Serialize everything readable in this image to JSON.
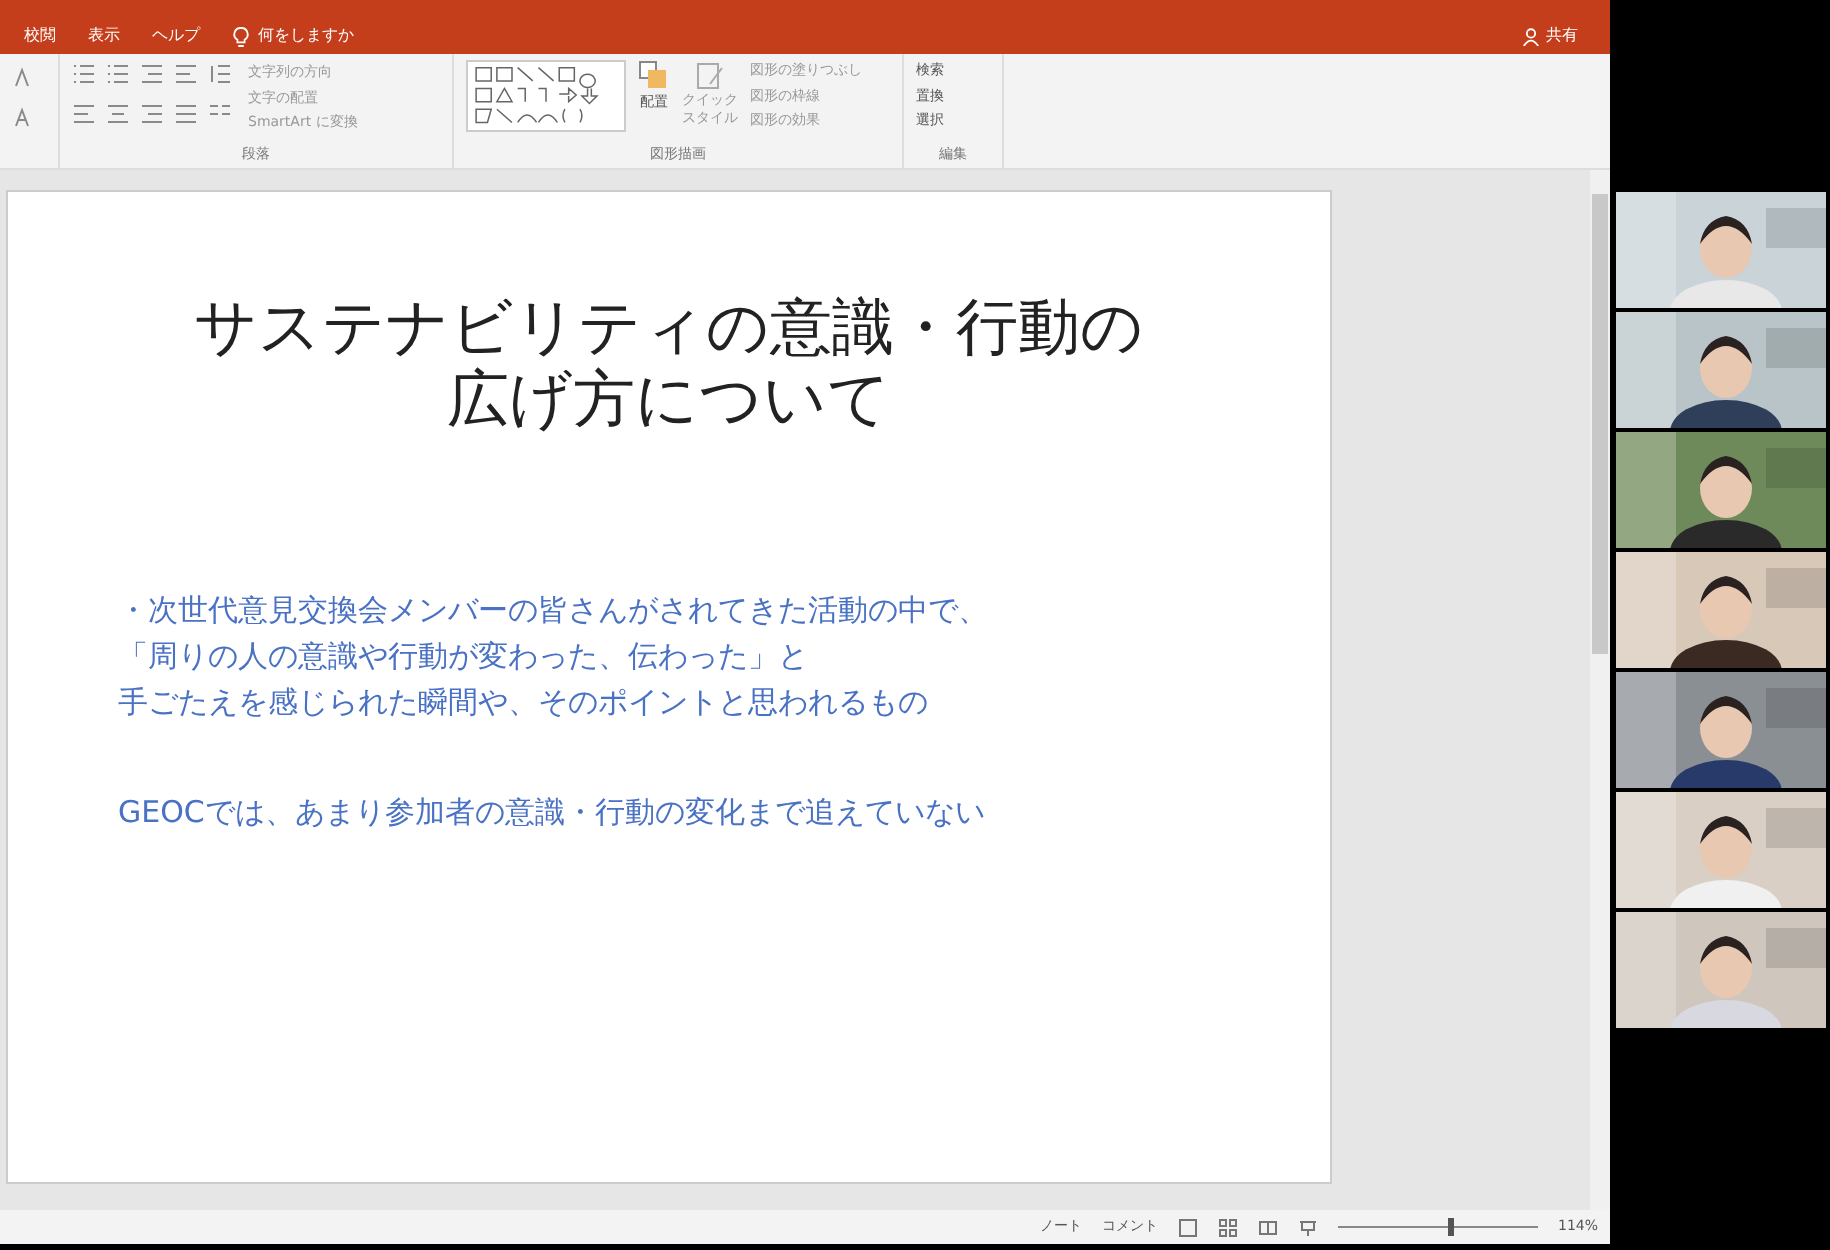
{
  "menu_tabs": [
    {
      "label": "校閲"
    },
    {
      "label": "表示"
    },
    {
      "label": "ヘルプ"
    }
  ],
  "tell_me": {
    "placeholder": "何をしますか"
  },
  "share_button": {
    "label": "共有"
  },
  "ribbon": {
    "paragraph": {
      "commands": [
        "文字列の方向",
        "文字の配置",
        "SmartArt に変換"
      ],
      "group_label": "段落"
    },
    "drawing": {
      "arrange": "配置",
      "quick_style": [
        "クイック",
        "スタイル"
      ],
      "commands": [
        "図形の塗りつぶし",
        "図形の枠線",
        "図形の効果"
      ],
      "group_label": "図形描画"
    },
    "editing": {
      "commands": [
        "検索",
        "置換",
        "選択"
      ],
      "group_label": "編集"
    }
  },
  "slide": {
    "title": [
      "サステナビリティの意識・行動の",
      "広げ方について"
    ],
    "body": [
      "・次世代意見交換会メンバーの皆さんがされてきた活動の中で、",
      "「周りの人の意識や行動が変わった、伝わった」と",
      "手ごたえを感じられた瞬間や、そのポイントと思われるもの"
    ],
    "note": "GEOCでは、あまり参加者の意識・行動の変化まで追えていない"
  },
  "status_bar": {
    "notes": "ノート",
    "comments": "コメント",
    "zoom": {
      "level": 0.55,
      "reading": "114%"
    }
  }
}
